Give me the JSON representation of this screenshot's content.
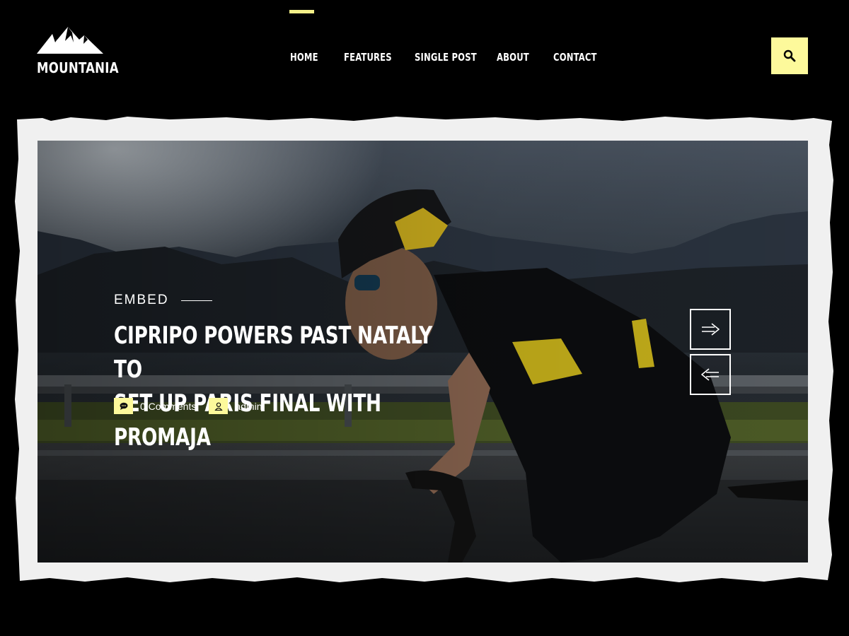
{
  "brand": {
    "name": "MOUNTANIA",
    "icon": "mountain-logo-icon"
  },
  "nav": {
    "items": [
      {
        "label": "HOME",
        "active": true
      },
      {
        "label": "FEATURES",
        "active": false
      },
      {
        "label": "SINGLE POST",
        "active": false
      },
      {
        "label": "ABOUT",
        "active": false
      },
      {
        "label": "CONTACT",
        "active": false
      }
    ],
    "search_icon": "search-icon"
  },
  "hero": {
    "category": "EMBED",
    "title_line1": "CIPRIPO POWERS PAST NATALY TO",
    "title_line2": "SET UP PARIS FINAL WITH PROMAJA",
    "comments": "0 Comments",
    "comments_icon": "comment-icon",
    "author": "admin",
    "author_icon": "user-icon",
    "next_icon": "arrow-right-icon",
    "prev_icon": "arrow-left-icon",
    "image_subject": "cyclist-photo"
  },
  "colors": {
    "accent": "#fdf99b",
    "background": "#000000",
    "frame": "#f0f0f0",
    "text": "#ffffff"
  }
}
